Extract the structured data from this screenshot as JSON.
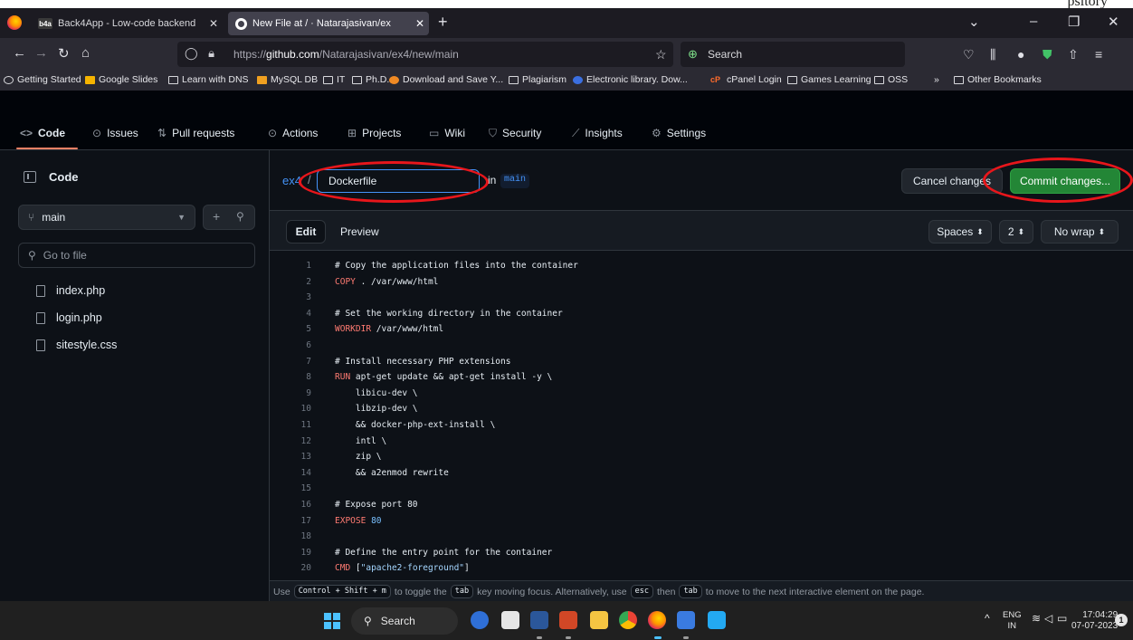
{
  "top_doc_text": "psitory",
  "browser": {
    "tabs": [
      {
        "label": "Back4App - Low-code backend",
        "favicon": "b4a"
      },
      {
        "label": "New File at / · Natarajasivan/ex",
        "favicon": "github"
      }
    ],
    "new_tab": "+",
    "url": {
      "prefix": "https://",
      "host": "github.com",
      "path": "/Natarajasivan/ex4/new/main"
    },
    "search_label": "Search",
    "bookmarks": [
      "Getting Started",
      "Google Slides",
      "Learn with DNS",
      "MySQL DB",
      "IT",
      "Ph.D.",
      "Download and Save Y...",
      "Plagiarism",
      "Electronic library. Dow...",
      "cPanel Login",
      "Games Learning",
      "OSS",
      "Other Bookmarks"
    ],
    "bookmarks_overflow": "»"
  },
  "repo_nav": [
    {
      "label": "Code",
      "icon": "code-icon"
    },
    {
      "label": "Issues",
      "icon": "issue-icon"
    },
    {
      "label": "Pull requests",
      "icon": "pull-request-icon"
    },
    {
      "label": "Actions",
      "icon": "play-icon"
    },
    {
      "label": "Projects",
      "icon": "table-icon"
    },
    {
      "label": "Wiki",
      "icon": "book-icon"
    },
    {
      "label": "Security",
      "icon": "shield-icon"
    },
    {
      "label": "Insights",
      "icon": "graph-icon"
    },
    {
      "label": "Settings",
      "icon": "gear-icon"
    }
  ],
  "sidebar": {
    "title": "Code",
    "branch": "main",
    "goto_placeholder": "Go to file",
    "files": [
      "index.php",
      "login.php",
      "sitestyle.css"
    ]
  },
  "editor_header": {
    "repo": "ex4",
    "separator": "/",
    "filename": "Dockerfile",
    "in_label": "in",
    "branch": "main",
    "cancel_label": "Cancel changes",
    "commit_label": "Commit changes..."
  },
  "editor": {
    "tab_edit": "Edit",
    "tab_preview": "Preview",
    "indent_mode": "Spaces",
    "indent_size": "2",
    "wrap_mode": "No wrap",
    "hint": {
      "use": "Use",
      "key1": "Control + Shift + m",
      "mid1": "to toggle the",
      "key2": "tab",
      "mid2": "key moving focus. Alternatively, use",
      "key3": "esc",
      "mid3": "then",
      "key4": "tab",
      "end": "to move to the next interactive element on the page."
    }
  },
  "code_lines": [
    {
      "n": "1",
      "parts": [
        {
          "t": "# Copy the application files into the container",
          "c": "comment"
        }
      ]
    },
    {
      "n": "2",
      "parts": [
        {
          "t": "COPY",
          "c": "kw"
        },
        {
          "t": " . /var/www/html",
          "c": ""
        }
      ]
    },
    {
      "n": "3",
      "parts": []
    },
    {
      "n": "4",
      "parts": [
        {
          "t": "# Set the working directory in the container",
          "c": "comment"
        }
      ]
    },
    {
      "n": "5",
      "parts": [
        {
          "t": "WORKDIR",
          "c": "kw"
        },
        {
          "t": " /var/www/html",
          "c": ""
        }
      ]
    },
    {
      "n": "6",
      "parts": []
    },
    {
      "n": "7",
      "parts": [
        {
          "t": "# Install necessary PHP extensions",
          "c": "comment"
        }
      ]
    },
    {
      "n": "8",
      "parts": [
        {
          "t": "RUN",
          "c": "kw"
        },
        {
          "t": " apt-get update && apt-get install -y \\",
          "c": ""
        }
      ]
    },
    {
      "n": "9",
      "parts": [
        {
          "t": "    libicu-dev \\",
          "c": ""
        }
      ]
    },
    {
      "n": "10",
      "parts": [
        {
          "t": "    libzip-dev \\",
          "c": ""
        }
      ]
    },
    {
      "n": "11",
      "parts": [
        {
          "t": "    && docker-php-ext-install \\",
          "c": ""
        }
      ]
    },
    {
      "n": "12",
      "parts": [
        {
          "t": "    intl \\",
          "c": ""
        }
      ]
    },
    {
      "n": "13",
      "parts": [
        {
          "t": "    zip \\",
          "c": ""
        }
      ]
    },
    {
      "n": "14",
      "parts": [
        {
          "t": "    && a2enmod rewrite",
          "c": ""
        }
      ]
    },
    {
      "n": "15",
      "parts": []
    },
    {
      "n": "16",
      "parts": [
        {
          "t": "# Expose port 80",
          "c": "comment"
        }
      ]
    },
    {
      "n": "17",
      "parts": [
        {
          "t": "EXPOSE",
          "c": "kw"
        },
        {
          "t": " ",
          "c": ""
        },
        {
          "t": "80",
          "c": "num"
        }
      ]
    },
    {
      "n": "18",
      "parts": []
    },
    {
      "n": "19",
      "parts": [
        {
          "t": "# Define the entry point for the container",
          "c": "comment"
        }
      ]
    },
    {
      "n": "20",
      "parts": [
        {
          "t": "CMD",
          "c": "kw"
        },
        {
          "t": " [",
          "c": ""
        },
        {
          "t": "\"apache2-foreground\"",
          "c": "str"
        },
        {
          "t": "]",
          "c": ""
        }
      ]
    }
  ],
  "taskbar": {
    "search_label": "Search",
    "lang_top": "ENG",
    "lang_bottom": "IN",
    "time": "17:04:29",
    "date": "07-07-2023",
    "notifications": "1"
  },
  "colors": {
    "accent_blue": "#4493f8",
    "commit_green": "#238636",
    "annotation_red": "#e8161b",
    "tab_underline": "#f78166"
  }
}
